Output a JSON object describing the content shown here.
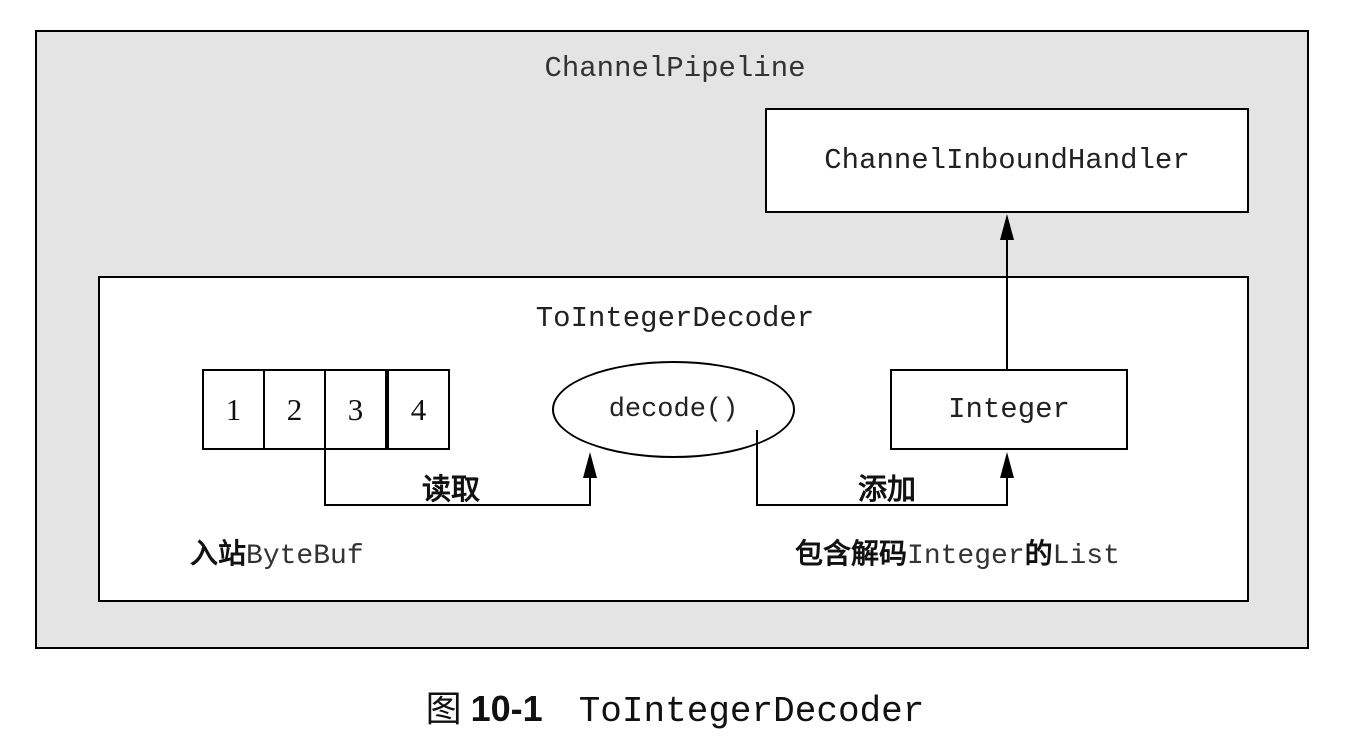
{
  "pipeline": {
    "label": "ChannelPipeline"
  },
  "handler": {
    "label": "ChannelInboundHandler"
  },
  "decoder": {
    "label": "ToIntegerDecoder",
    "bytes": [
      "1",
      "2",
      "3",
      "4"
    ],
    "decode_label": "decode()",
    "integer_label": "Integer",
    "read_label": "读取",
    "add_label": "添加",
    "inbound_note": {
      "cn": "入站",
      "code": "ByteBuf"
    },
    "list_note": {
      "cn1": "包含解码",
      "code1": "Integer",
      "cn2": "的",
      "code2": "List"
    }
  },
  "caption": {
    "prefix": "图",
    "number": "10-1",
    "title": "ToIntegerDecoder"
  }
}
